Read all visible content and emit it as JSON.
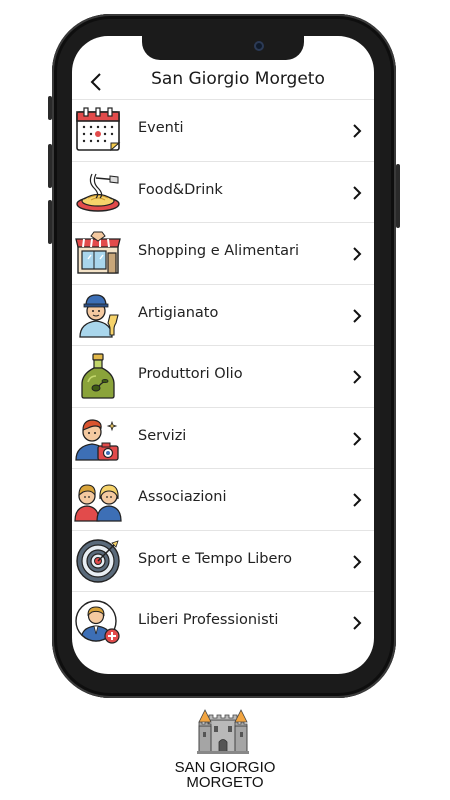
{
  "header": {
    "title": "San Giorgio Morgeto"
  },
  "items": [
    {
      "label": "Eventi",
      "icon": "calendar-icon"
    },
    {
      "label": "Food&Drink",
      "icon": "pasta-icon"
    },
    {
      "label": "Shopping e Alimentari",
      "icon": "shop-icon"
    },
    {
      "label": "Artigianato",
      "icon": "artisan-icon"
    },
    {
      "label": "Produttori Olio",
      "icon": "olive-oil-icon"
    },
    {
      "label": "Servizi",
      "icon": "photographer-icon"
    },
    {
      "label": "Associazioni",
      "icon": "people-icon"
    },
    {
      "label": "Sport e Tempo Libero",
      "icon": "target-icon"
    },
    {
      "label": "Liberi Professionisti",
      "icon": "professional-icon"
    }
  ],
  "brand": {
    "line1": "SAN GIORGIO",
    "line2": "MORGETO"
  },
  "colors": {
    "red": "#e24b4b",
    "tan": "#f4c9a0",
    "blue": "#3d6fb6",
    "olive": "#6b8e23"
  }
}
